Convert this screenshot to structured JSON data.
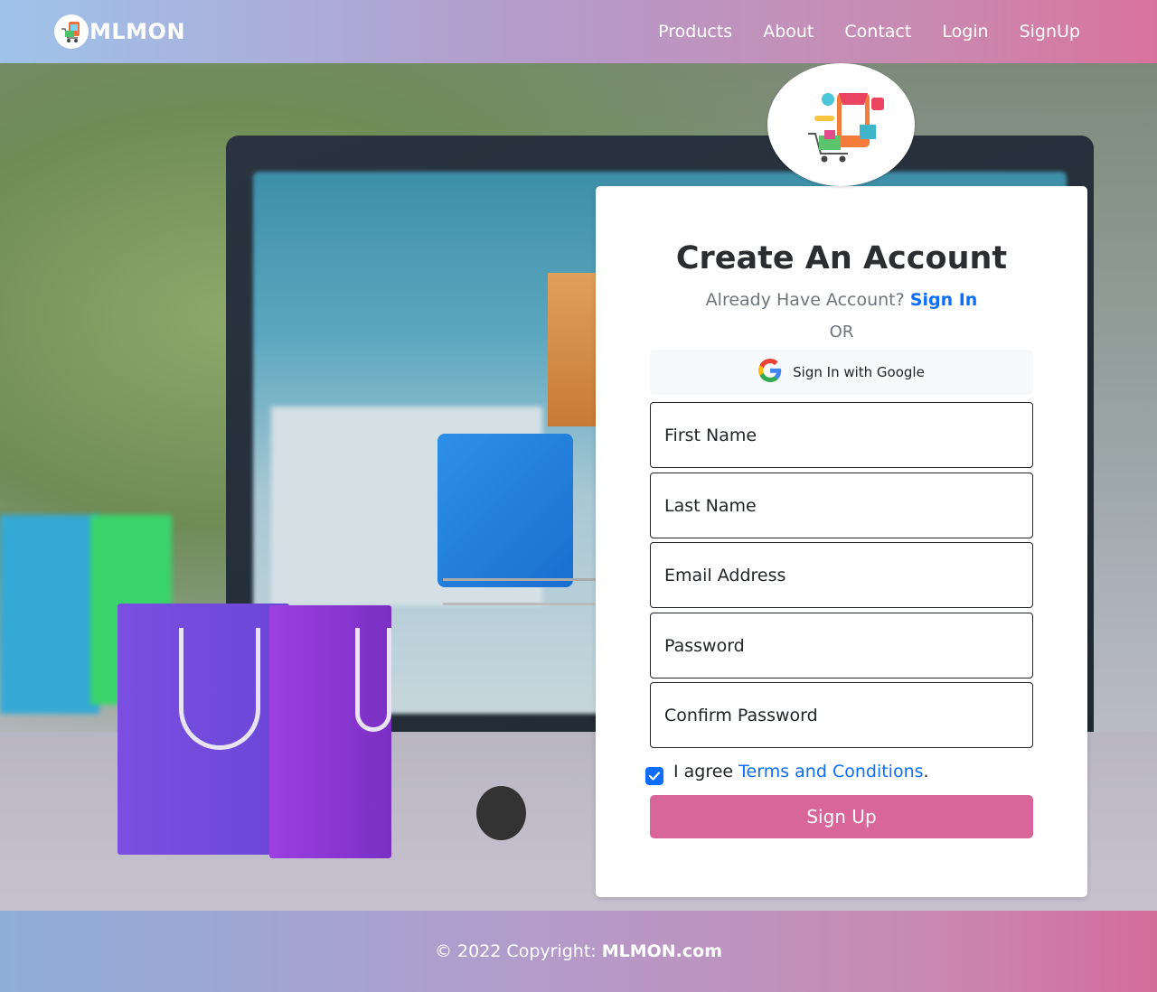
{
  "nav": {
    "brand": "MLMON",
    "links": [
      "Products",
      "About",
      "Contact",
      "Login",
      "SignUp"
    ]
  },
  "form": {
    "title": "Create An Account",
    "subtitle": "Already Have Account?",
    "signin_link": "Sign In",
    "or": "OR",
    "google_label": "Sign In with Google",
    "fields": {
      "first_name": "First Name",
      "last_name": "Last Name",
      "email": "Email Address",
      "password": "Password",
      "confirm_password": "Confirm Password"
    },
    "agree_text": "I agree",
    "terms_link": "Terms and Conditions",
    "terms_period": ".",
    "submit": "Sign Up"
  },
  "footer": {
    "copyright": "© 2022 Copyright:",
    "site": "MLMON.com"
  },
  "colors": {
    "accent": "#d9669a",
    "link": "#0d6efd"
  }
}
